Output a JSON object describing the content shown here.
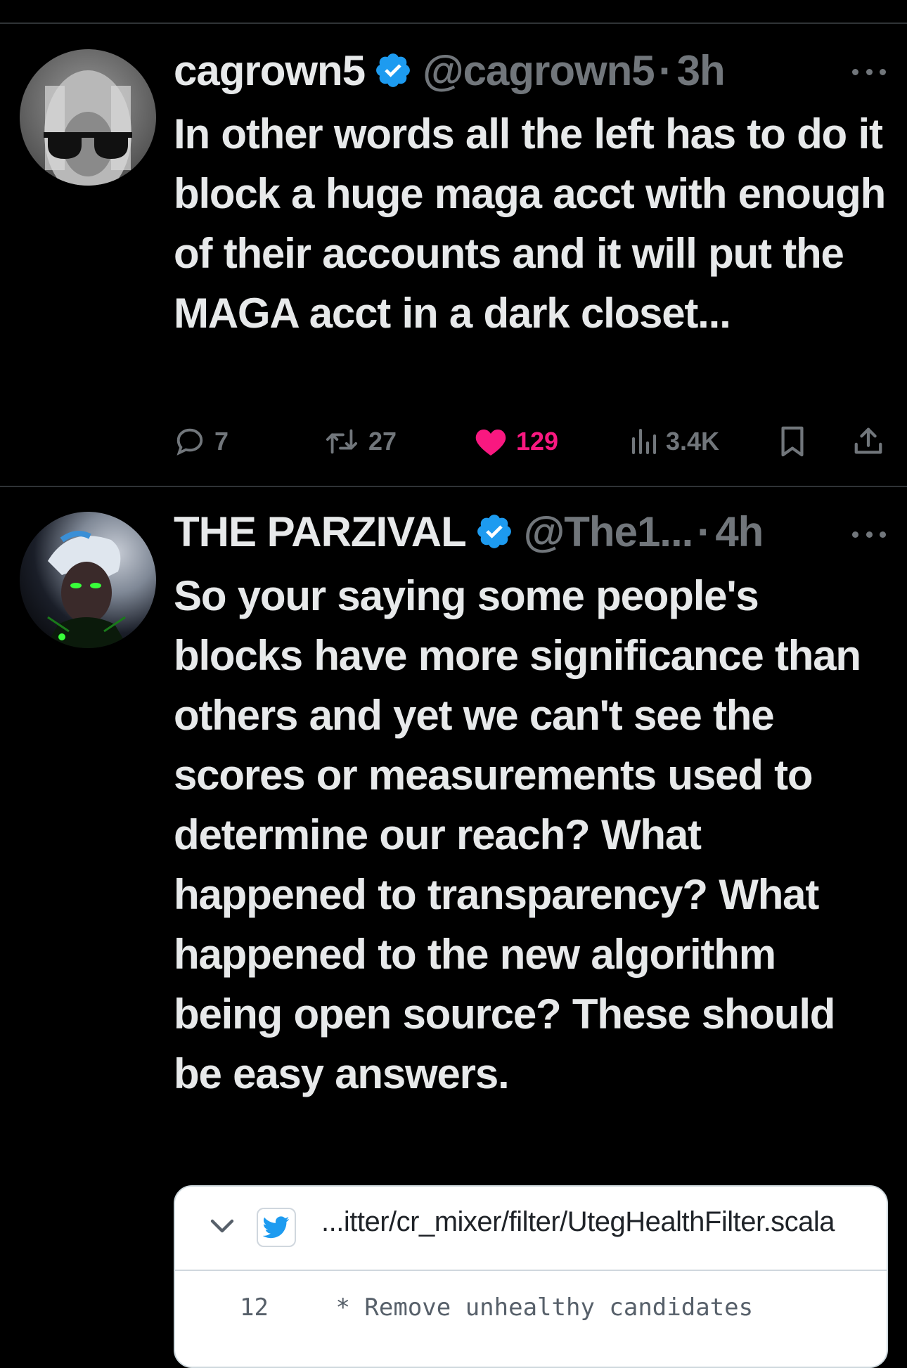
{
  "tweets": [
    {
      "display_name": "cagrown5",
      "handle": "@cagrown5",
      "separator": "·",
      "time": "3h",
      "text": "In other words all the left has to do it block a huge maga acct with enough of their accounts and it will put the MAGA acct in a dark closet...",
      "replies": "7",
      "retweets": "27",
      "likes": "129",
      "views": "3.4K"
    },
    {
      "display_name": "THE PARZIVAL",
      "handle": "@The1...",
      "separator": "·",
      "time": "4h",
      "text": "So your saying some people's blocks have more significance than others and yet we can't see the scores or measurements used to determine our reach? What happened to transparency? What happened to the new algorithm being open source?  These should be easy answers."
    }
  ],
  "embedded_card": {
    "path": "...itter/cr_mixer/filter/UtegHealthFilter.scala",
    "line_number": "12",
    "code_line": " * Remove unhealthy candidates"
  },
  "colors": {
    "background": "#000000",
    "text": "#e7e9ea",
    "muted": "#71767b",
    "like": "#f91880",
    "verified": "#1d9bf0"
  }
}
